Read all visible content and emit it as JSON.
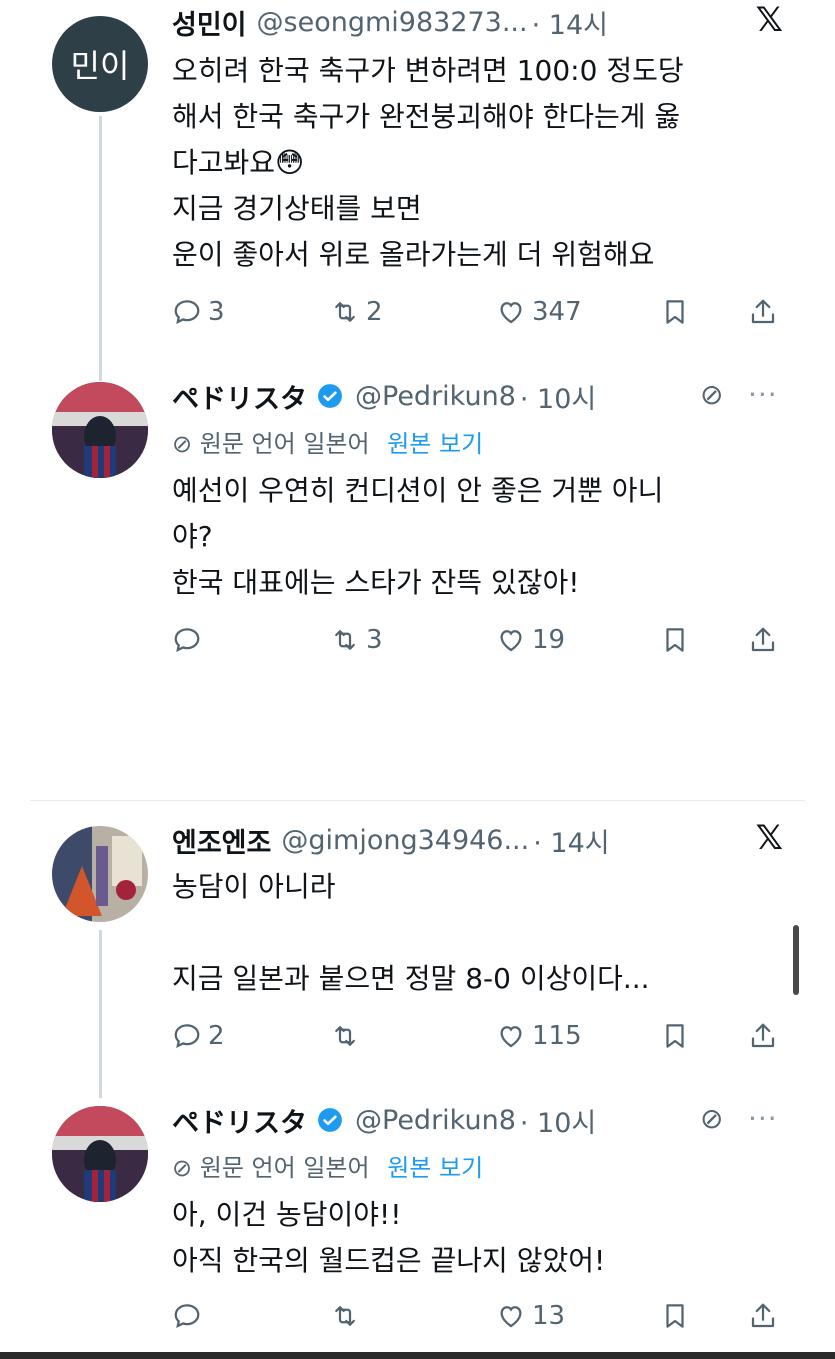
{
  "tweets": [
    {
      "avatar_text": "민이",
      "name": "성민이",
      "handle": "@seongmi983273...",
      "time": "· 14시",
      "body": "오히려 한국 축구가 변하려면 100:0 정도당\n해서 한국 축구가 완전붕괴해야 한다는게 옳\n다고봐요😳\n지금 경기상태를 보면\n운이 좋아서 위로 올라가는게 더 위험해요",
      "replies": "3",
      "retweets": "2",
      "likes": "347"
    },
    {
      "name": "ペドリスタ",
      "handle": "@Pedrikun8",
      "time": "· 10시",
      "translate_label": "원문 언어 일본어",
      "translate_link": "원본 보기",
      "body": "예선이 우연히 컨디션이 안 좋은 거뿐 아니\n야?\n한국 대표에는 스타가 잔뜩 있잖아!",
      "replies": "",
      "retweets": "3",
      "likes": "19"
    },
    {
      "name": "엔조엔조",
      "handle": "@gimjong34946...",
      "time": "· 14시",
      "body": "농담이 아니라\n\n지금 일본과 붙으면 정말 8-0 이상이다...",
      "replies": "2",
      "retweets": "",
      "likes": "115"
    },
    {
      "name": "ペドリスタ",
      "handle": "@Pedrikun8",
      "time": "· 10시",
      "translate_label": "원문 언어 일본어",
      "translate_link": "원본 보기",
      "body": "아, 이건 농담이야!!\n아직 한국의 월드컵은 끝나지 않았어!",
      "replies": "",
      "retweets": "",
      "likes": "13"
    }
  ],
  "icons": {
    "x_logo": "x-logo-icon",
    "reply": "reply-icon",
    "retweet": "retweet-icon",
    "like": "heart-icon",
    "bookmark": "bookmark-icon",
    "share": "share-icon",
    "verified": "verified-badge-icon",
    "hidden": "hidden-eye-icon",
    "more": "more-icon"
  },
  "colors": {
    "link": "#1d9bf0",
    "muted": "#536471",
    "verified": "#1d9bf0"
  }
}
